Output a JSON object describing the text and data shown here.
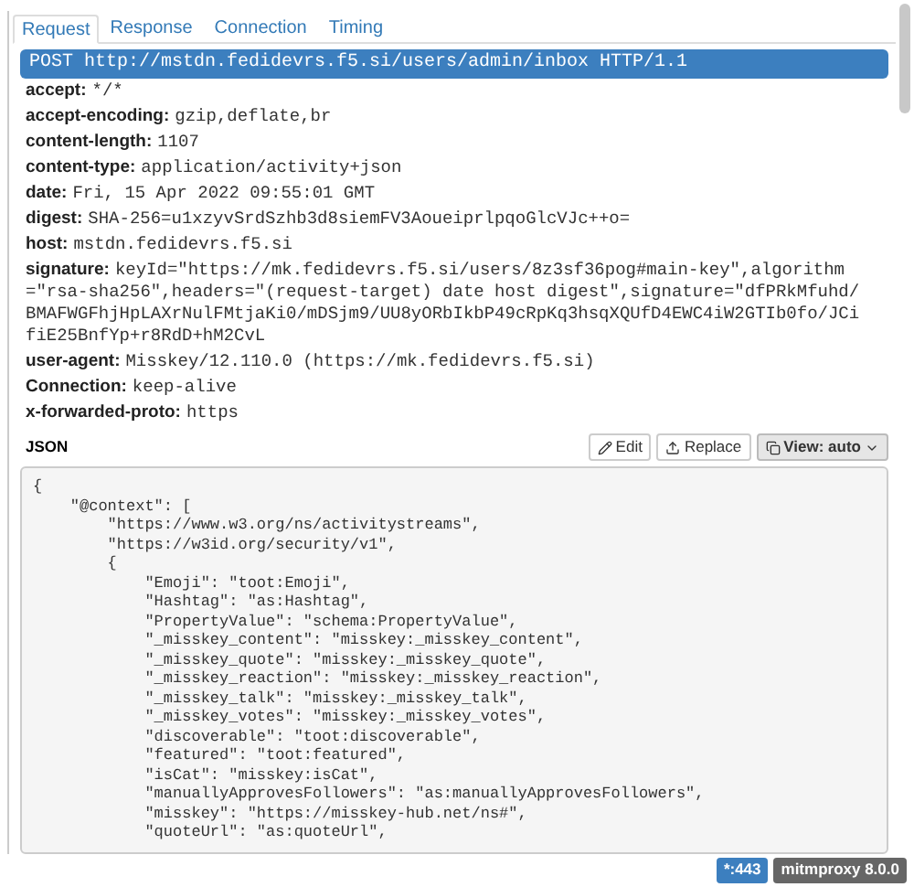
{
  "tabs": [
    {
      "label": "Request",
      "selected": true
    },
    {
      "label": "Response",
      "selected": false
    },
    {
      "label": "Connection",
      "selected": false
    },
    {
      "label": "Timing",
      "selected": false
    }
  ],
  "request_line": "POST http://mstdn.fedidevrs.f5.si/users/admin/inbox HTTP/1.1",
  "headers": [
    {
      "name": "accept:",
      "value": "*/*"
    },
    {
      "name": "accept-encoding:",
      "value": "gzip,deflate,br"
    },
    {
      "name": "content-length:",
      "value": "1107"
    },
    {
      "name": "content-type:",
      "value": "application/activity+json"
    },
    {
      "name": "date:",
      "value": "Fri, 15 Apr 2022 09:55:01 GMT"
    },
    {
      "name": "digest:",
      "value": "SHA-256=u1xzyvSrdSzhb3d8siemFV3AoueiprlpqoGlcVJc++o="
    },
    {
      "name": "host:",
      "value": "mstdn.fedidevrs.f5.si"
    },
    {
      "name": "signature:",
      "value": "keyId=\"https://mk.fedidevrs.f5.si/users/8z3sf36pog#main-key\",algorithm=\"rsa-sha256\",headers=\"(request-target) date host digest\",signature=\"dfPRkMfuhd/BMAFWGFhjHpLAXrNulFMtjaKi0/mDSjm9/UU8yORbIkbP49cRpKq3hsqXQUfD4EWC4iW2GTIb0fo/JCifiE25BnfYp+r8RdD+hM2CvL"
    },
    {
      "name": "user-agent:",
      "value": "Misskey/12.110.0 (https://mk.fedidevrs.f5.si)"
    },
    {
      "name": "Connection:",
      "value": "keep-alive"
    },
    {
      "name": "x-forwarded-proto:",
      "value": "https"
    }
  ],
  "body": {
    "title": "JSON",
    "buttons": [
      {
        "label": "Edit",
        "kind": "edit"
      },
      {
        "label": "Replace",
        "kind": "replace"
      },
      {
        "label": "View: auto",
        "kind": "view"
      }
    ],
    "lines": [
      "{",
      "    \"@context\": [",
      "        \"https://www.w3.org/ns/activitystreams\",",
      "        \"https://w3id.org/security/v1\",",
      "        {",
      "            \"Emoji\": \"toot:Emoji\",",
      "            \"Hashtag\": \"as:Hashtag\",",
      "            \"PropertyValue\": \"schema:PropertyValue\",",
      "            \"_misskey_content\": \"misskey:_misskey_content\",",
      "            \"_misskey_quote\": \"misskey:_misskey_quote\",",
      "            \"_misskey_reaction\": \"misskey:_misskey_reaction\",",
      "            \"_misskey_talk\": \"misskey:_misskey_talk\",",
      "            \"_misskey_votes\": \"misskey:_misskey_votes\",",
      "            \"discoverable\": \"toot:discoverable\",",
      "            \"featured\": \"toot:featured\",",
      "            \"isCat\": \"misskey:isCat\",",
      "            \"manuallyApprovesFollowers\": \"as:manuallyApprovesFollowers\",",
      "            \"misskey\": \"https://misskey-hub.net/ns#\",",
      "            \"quoteUrl\": \"as:quoteUrl\","
    ]
  },
  "status_bar": [
    {
      "label": "*:443",
      "kind": "port"
    },
    {
      "label": "mitmproxy 8.0.0",
      "kind": "version"
    }
  ]
}
